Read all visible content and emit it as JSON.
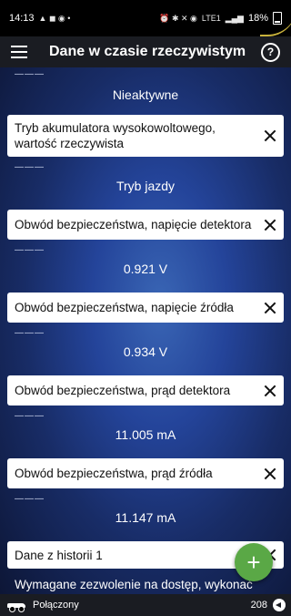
{
  "status_bar": {
    "time": "14:13",
    "battery": "18%",
    "network_label": "LTE1"
  },
  "app_bar": {
    "title": "Dane w czasie rzeczywistym"
  },
  "top_value": {
    "dash": "———",
    "value": "Nieaktywne"
  },
  "items": [
    {
      "label": "Tryb akumulatora wysokowoltowego, wartość rzeczywista",
      "dash": "———",
      "value": "Tryb jazdy"
    },
    {
      "label": "Obwód bezpieczeństwa, napięcie detektora",
      "dash": "———",
      "value": "0.921 V"
    },
    {
      "label": "Obwód bezpieczeństwa, napięcie źródła",
      "dash": "———",
      "value": "0.934 V"
    },
    {
      "label": "Obwód bezpieczeństwa, prąd detektora",
      "dash": "———",
      "value": "11.005 mA"
    },
    {
      "label": "Obwód bezpieczeństwa, prąd źródła",
      "dash": "———",
      "value": "11.147 mA"
    }
  ],
  "history": {
    "label": "Dane z historii 1",
    "partial_text": "Wymagane zezwolenie na dostęp, wykonać"
  },
  "footer": {
    "status": "Połączony",
    "count": "208"
  },
  "fab": {
    "icon": "plus-icon",
    "glyph": "+"
  },
  "colors": {
    "fab": "#5aa846",
    "bar": "#1a1c22",
    "accent_blue": "#2a4ea6"
  }
}
